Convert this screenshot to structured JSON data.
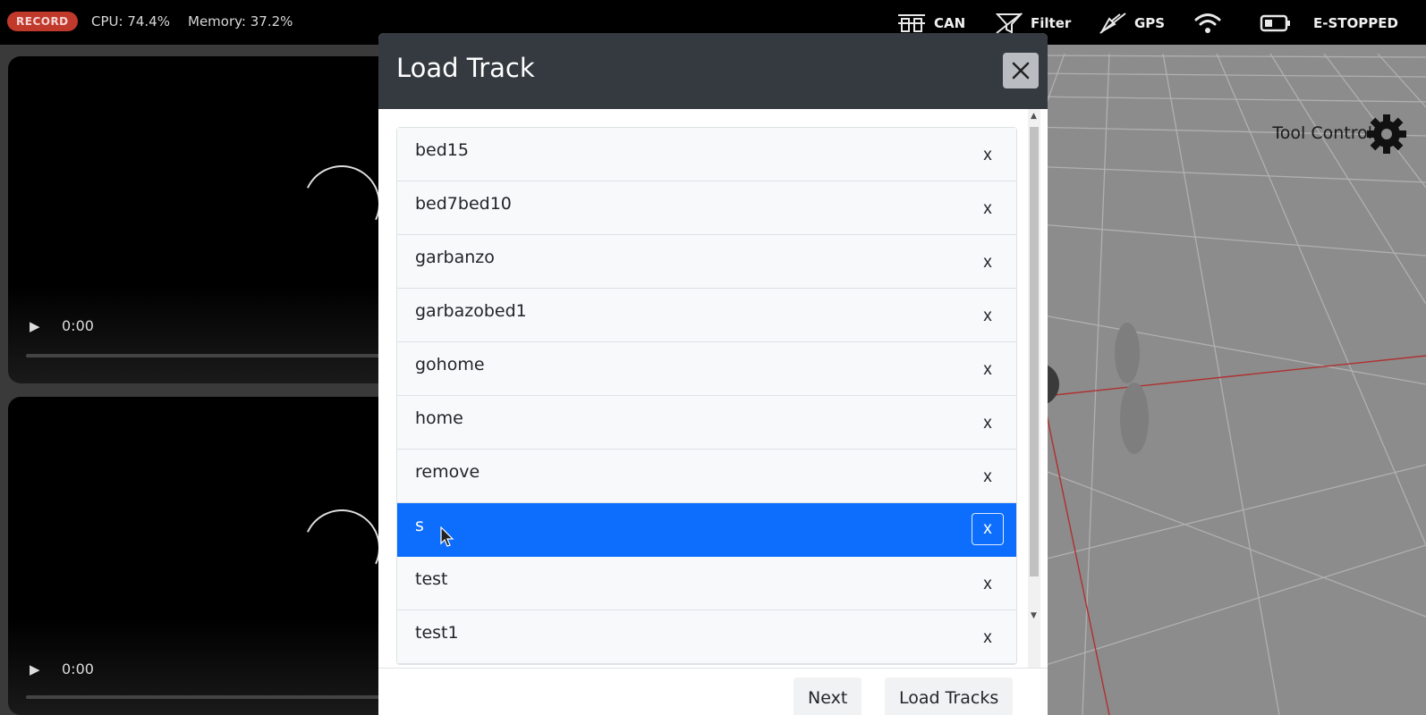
{
  "topbar": {
    "record_label": "RECORD",
    "cpu": "CPU: 74.4%",
    "memory": "Memory: 37.2%",
    "status": [
      {
        "label": "CAN",
        "icon": "can-bus-icon"
      },
      {
        "label": "Filter",
        "icon": "filter-icon"
      },
      {
        "label": "GPS",
        "icon": "satellite-icon"
      },
      {
        "label": "",
        "icon": "wifi-icon"
      },
      {
        "label": "",
        "icon": "battery-icon"
      },
      {
        "label": "E-STOPPED",
        "icon": ""
      }
    ]
  },
  "video": [
    {
      "time": "0:00"
    },
    {
      "time": "0:00"
    }
  ],
  "scene": {
    "tool_control_label": "Tool Control"
  },
  "modal": {
    "title": "Load Track",
    "tracks": [
      {
        "name": "bed15",
        "delete_label": "x"
      },
      {
        "name": "bed7bed10",
        "delete_label": "x"
      },
      {
        "name": "garbanzo",
        "delete_label": "x"
      },
      {
        "name": "garbazobed1",
        "delete_label": "x"
      },
      {
        "name": "gohome",
        "delete_label": "x"
      },
      {
        "name": "home",
        "delete_label": "x"
      },
      {
        "name": "remove",
        "delete_label": "x"
      },
      {
        "name": "s",
        "delete_label": "x",
        "selected": true
      },
      {
        "name": "test",
        "delete_label": "x"
      },
      {
        "name": "test1",
        "delete_label": "x"
      }
    ],
    "next_label": "Next",
    "load_label": "Load Tracks"
  },
  "colors": {
    "selected": "#0d6efd",
    "header": "#343a40",
    "record": "#c0392b"
  }
}
